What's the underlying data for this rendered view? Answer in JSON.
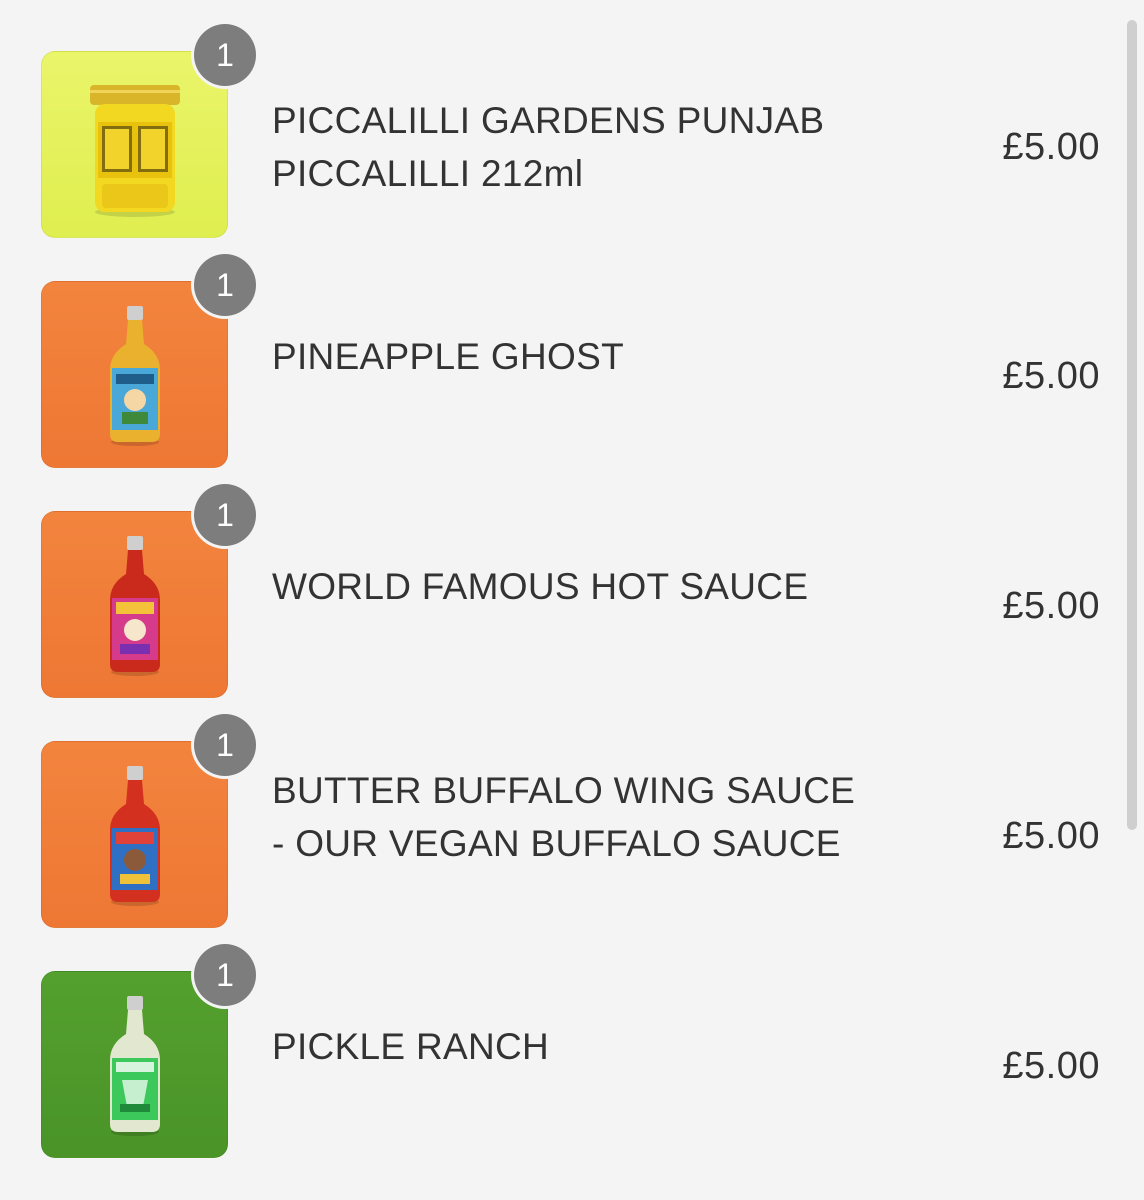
{
  "cart": {
    "items": [
      {
        "quantity": "1",
        "name": "PICCALILLI GARDENS PUNJAB\nPICCALILLI 212ml",
        "price": "£5.00",
        "image_bg": "#e6f25a",
        "product": "jar-icon",
        "accent": "#f0d21a"
      },
      {
        "quantity": "1",
        "name": "PINEAPPLE GHOST",
        "price": "£5.00",
        "image_bg": "#f07f3a",
        "product": "bottle-icon",
        "accent": "#4aa8d8"
      },
      {
        "quantity": "1",
        "name": "WORLD FAMOUS HOT SAUCE",
        "price": "£5.00",
        "image_bg": "#f07f3a",
        "product": "bottle-icon",
        "accent": "#d63a8a"
      },
      {
        "quantity": "1",
        "name": "BUTTER BUFFALO WING SAUCE\n- OUR VEGAN BUFFALO SAUCE",
        "price": "£5.00",
        "image_bg": "#f07f3a",
        "product": "bottle-icon",
        "accent": "#2f6fc4"
      },
      {
        "quantity": "1",
        "name": "PICKLE RANCH",
        "price": "£5.00",
        "image_bg": "#4f9a2c",
        "product": "bottle-icon",
        "accent": "#3cc85a"
      }
    ]
  },
  "colors": {
    "background": "#f4f4f4",
    "badge": "#7d7d7d",
    "text": "#333333"
  }
}
